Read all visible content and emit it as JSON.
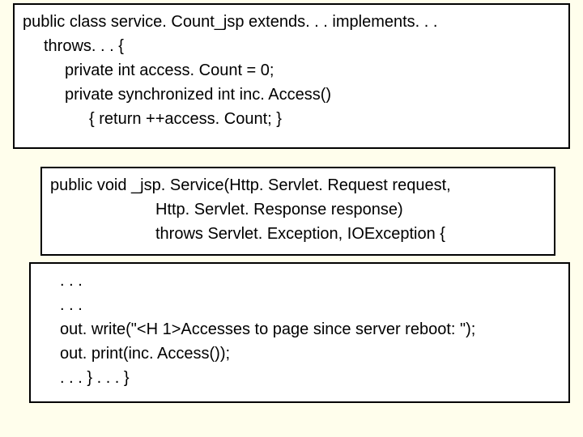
{
  "box1": {
    "l1": "public class service. Count_jsp extends. . . implements. . .",
    "l2": "throws. . . {",
    "l3": "private int access. Count = 0;",
    "l4": "private synchronized int inc. Access()",
    "l5": "{ return ++access. Count; }"
  },
  "box2": {
    "l1": "public void _jsp. Service(Http. Servlet. Request request,",
    "l2": "Http. Servlet. Response response)",
    "l3": "throws Servlet. Exception, IOException {"
  },
  "box3": {
    "l1": ". . .",
    "l2": ". . .",
    "l3": "out. write(\"<H 1>Accesses to page since server reboot: \");",
    "l4": "out. print(inc. Access());",
    "l5": ". . . } . . . }"
  }
}
